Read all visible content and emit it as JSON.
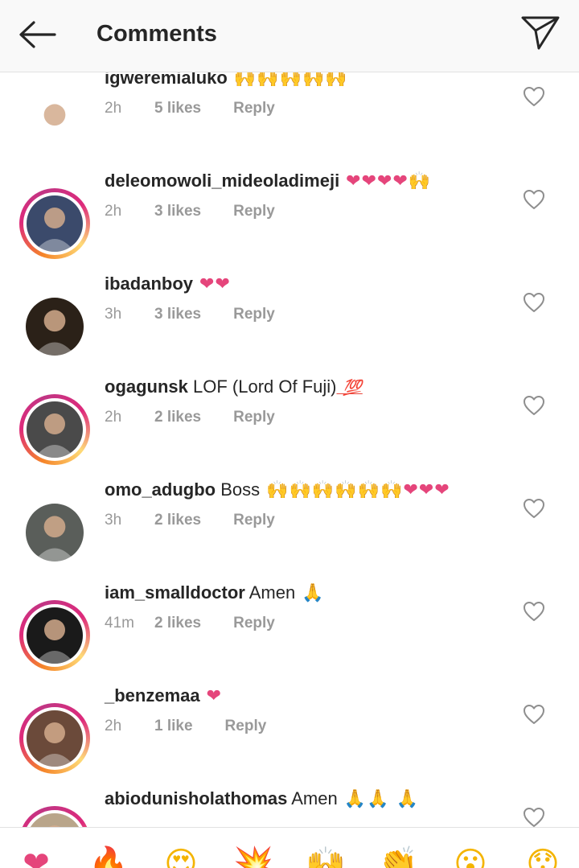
{
  "header": {
    "title": "Comments",
    "back_icon": "back-arrow-icon",
    "send_icon": "paper-plane-icon"
  },
  "comments": [
    {
      "username": "igweremialuko",
      "text": "",
      "emoji": "🙌🙌🙌🙌🙌",
      "emoji_kind": "hands",
      "time": "2h",
      "likes": "5 likes",
      "reply": "Reply",
      "avatar_ring": false,
      "avatar_color": "#ffffff"
    },
    {
      "username": "deleomowoli_mideoladimeji",
      "text": "",
      "emoji": "❤❤❤❤",
      "emoji2": "🙌",
      "emoji_kind": "hearts",
      "time": "2h",
      "likes": "3 likes",
      "reply": "Reply",
      "avatar_ring": true,
      "avatar_color": "#3b4a6b"
    },
    {
      "username": "ibadanboy",
      "text": "",
      "emoji": "❤❤",
      "emoji_kind": "hearts",
      "time": "3h",
      "likes": "3 likes",
      "reply": "Reply",
      "avatar_ring": false,
      "avatar_color": "#2b2118"
    },
    {
      "username": "ogagunsk",
      "text": "LOF (Lord Of Fuji)",
      "emoji": "💯",
      "emoji_kind": "hundred",
      "time": "2h",
      "likes": "2 likes",
      "reply": "Reply",
      "avatar_ring": true,
      "avatar_color": "#4a4a4a"
    },
    {
      "username": "omo_adugbo",
      "text": "Boss",
      "emoji": "🙌🙌🙌🙌🙌🙌",
      "emoji2": "❤❤❤",
      "emoji_kind": "hands",
      "time": "3h",
      "likes": "2 likes",
      "reply": "Reply",
      "avatar_ring": false,
      "avatar_color": "#5a5e5a"
    },
    {
      "username": "iam_smalldoctor",
      "text": "Amen",
      "emoji": "🙏",
      "emoji_kind": "pray-dark",
      "time": "41m",
      "likes": "2 likes",
      "reply": "Reply",
      "avatar_ring": true,
      "avatar_color": "#1a1a1a"
    },
    {
      "username": "_benzemaa",
      "text": "",
      "emoji": "❤",
      "emoji_kind": "hearts",
      "time": "2h",
      "likes": "1 like",
      "reply": "Reply",
      "avatar_ring": true,
      "avatar_color": "#6b4a3a"
    },
    {
      "username": "abiodunisholathomas",
      "text": "Amen",
      "emoji": "🙏🙏 🙏",
      "emoji_kind": "pray",
      "time": "",
      "likes": "",
      "reply": "",
      "avatar_ring": true,
      "avatar_color": "#b9a58a"
    }
  ],
  "reactions": [
    {
      "name": "heart-reaction",
      "glyph": "❤",
      "color": "#e5457b"
    },
    {
      "name": "fire-reaction",
      "glyph": "🔥",
      "color": "#f26a1b"
    },
    {
      "name": "heart-eyes-reaction",
      "glyph": "😍",
      "color": "#f4b400"
    },
    {
      "name": "explosion-reaction",
      "glyph": "💥",
      "color": "#f2541b"
    },
    {
      "name": "raised-hands-reaction",
      "glyph": "🙌",
      "color": "#f4b400"
    },
    {
      "name": "clap-reaction",
      "glyph": "👏",
      "color": "#f4b400"
    },
    {
      "name": "surprised-face-reaction",
      "glyph": "😮",
      "color": "#f4b400"
    },
    {
      "name": "face-reaction",
      "glyph": "😯",
      "color": "#f4b400"
    }
  ]
}
